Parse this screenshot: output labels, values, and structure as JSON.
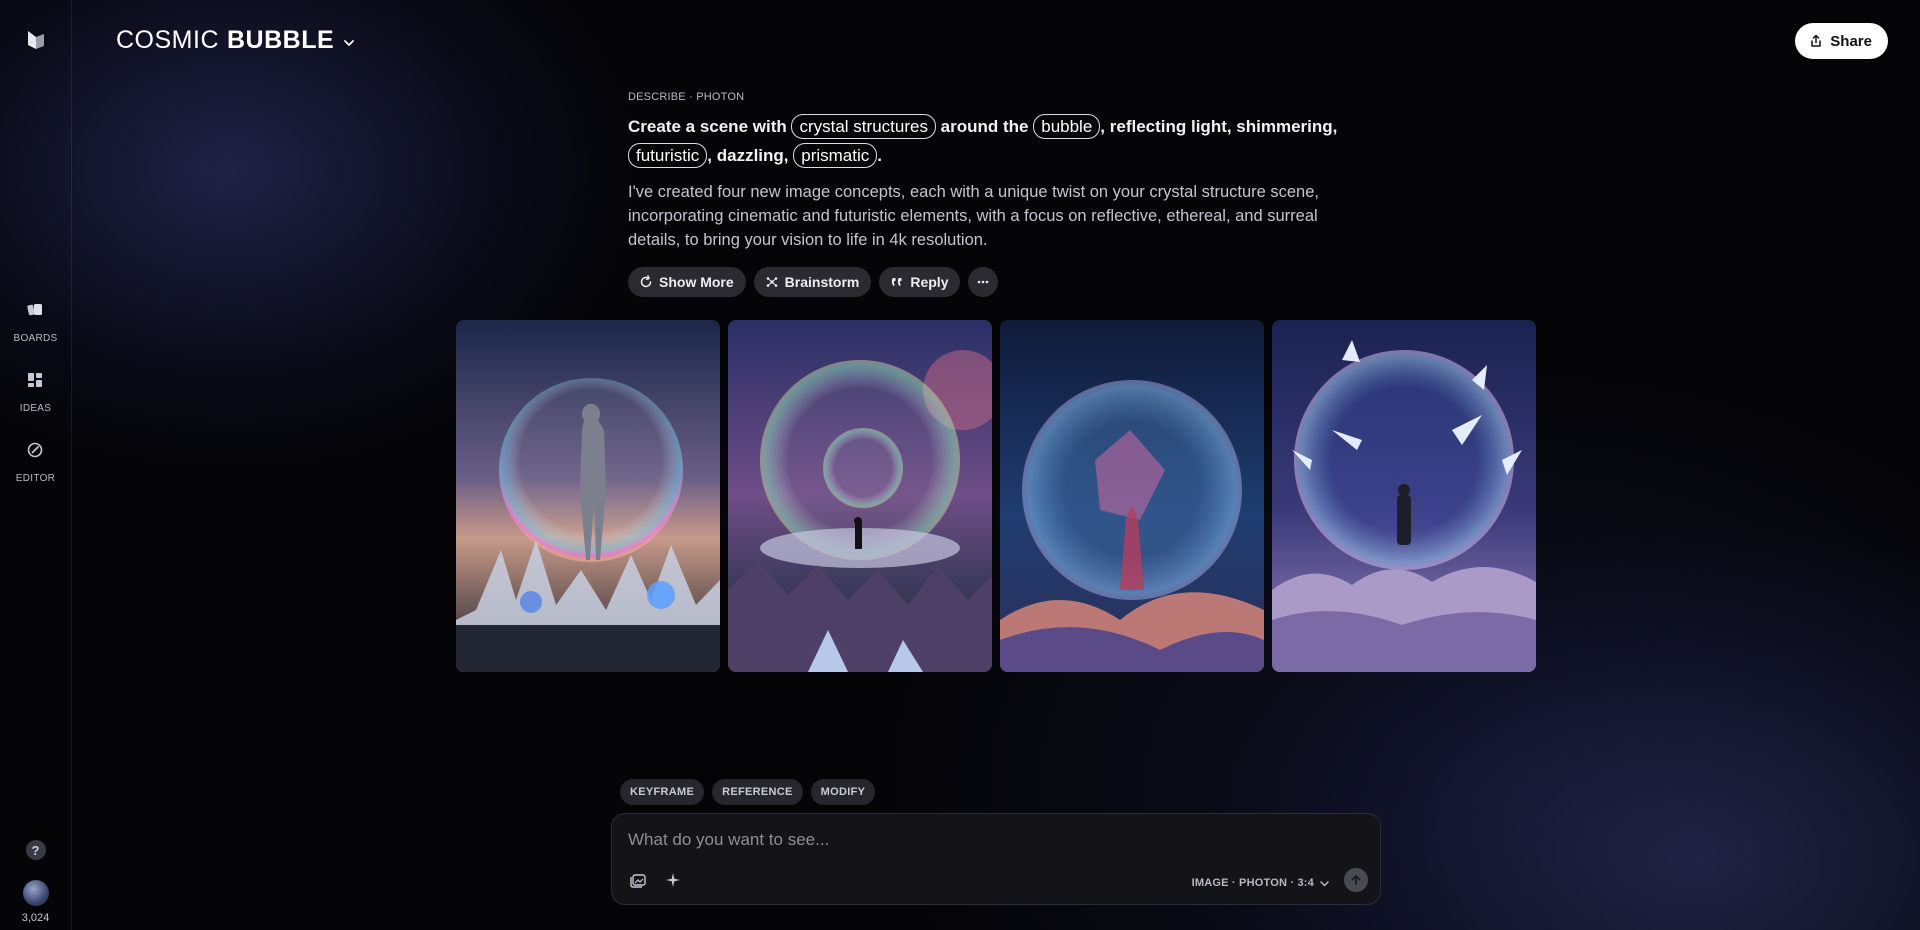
{
  "app": {
    "accent": "#ffffff",
    "background": "#050508"
  },
  "header": {
    "title_light": "COSMIC",
    "title_bold": "BUBBLE",
    "share_label": "Share"
  },
  "sidebar": {
    "items": [
      {
        "label": "BOARDS",
        "icon": "boards-icon"
      },
      {
        "label": "IDEAS",
        "icon": "ideas-icon"
      },
      {
        "label": "EDITOR",
        "icon": "editor-icon"
      }
    ],
    "help_glyph": "?",
    "credits": "3,024"
  },
  "generation": {
    "meta": "DESCRIBE · PHOTON",
    "prompt": {
      "t1": "Create a scene with ",
      "k1": "crystal structures",
      "t2": " around the ",
      "k2": "bubble",
      "t3": ", reflecting light, shimmering, ",
      "k3": "futuristic",
      "t4": ", dazzling, ",
      "k4": "prismatic",
      "t5": "."
    },
    "response": "I've created four new image concepts, each with a unique twist on your crystal structure scene, incorporating cinematic and futuristic elements, with a focus on reflective, ethereal, and surreal details, to bring your vision to life in 4k resolution.",
    "actions": {
      "show_more": "Show More",
      "brainstorm": "Brainstorm",
      "reply": "Reply"
    },
    "images": [
      {
        "icon": "generated-image-1"
      },
      {
        "icon": "generated-image-2"
      },
      {
        "icon": "generated-image-3"
      },
      {
        "icon": "generated-image-4"
      }
    ]
  },
  "composer": {
    "tags": [
      "KEYFRAME",
      "REFERENCE",
      "MODIFY"
    ],
    "placeholder": "What do you want to see...",
    "settings_label": "IMAGE · PHOTON · 3:4"
  }
}
